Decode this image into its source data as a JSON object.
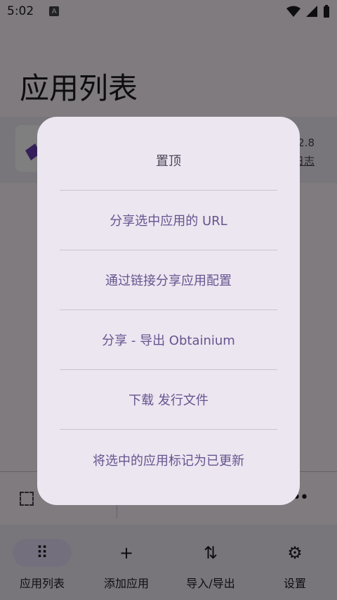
{
  "status_bar": {
    "time": "5:02",
    "notif_icon_label": "A"
  },
  "page": {
    "title": "应用列表"
  },
  "app_row": {
    "version": "2.8",
    "changelog": "日志"
  },
  "dialog": {
    "items": [
      "置顶",
      "分享选中应用的 URL",
      "通过链接分享应用配置",
      "分享 - 导出 Obtainium",
      "下载 发行文件",
      "将选中的应用标记为已更新"
    ]
  },
  "bottom_actions": {
    "more_label": "•••"
  },
  "nav": {
    "items": [
      {
        "label": "应用列表",
        "icon": "grid-icon",
        "glyph": "⠿"
      },
      {
        "label": "添加应用",
        "icon": "plus-icon",
        "glyph": "+"
      },
      {
        "label": "导入/导出",
        "icon": "swap-vertical-icon",
        "glyph": "⇅"
      },
      {
        "label": "设置",
        "icon": "gear-icon",
        "glyph": "⚙"
      }
    ],
    "active_index": 0
  },
  "colors": {
    "accent": "#65558f",
    "surface": "#ece6f0",
    "scrim": "rgba(0,0,0,0.5)"
  }
}
